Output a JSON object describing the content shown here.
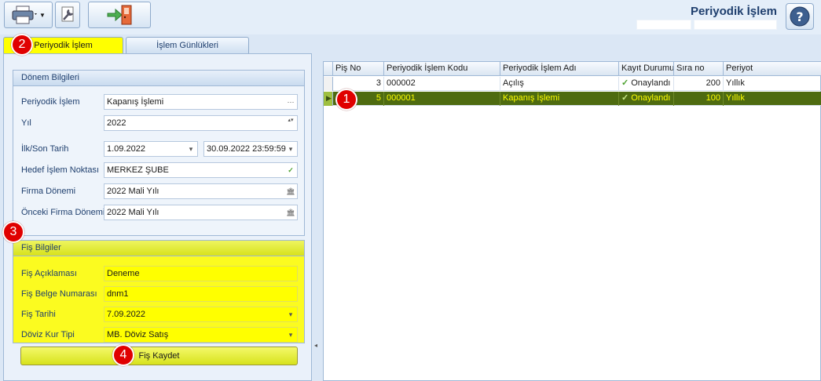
{
  "header": {
    "title": "Periyodik İşlem"
  },
  "tabs": [
    {
      "label": "Periyodik İşlem"
    },
    {
      "label": "İşlem Günlükleri"
    }
  ],
  "donem": {
    "title": "Dönem Bilgileri",
    "fields": [
      {
        "label": "Periyodik İşlem",
        "value": "Kapanış İşlemi",
        "button": "···"
      },
      {
        "label": "Yıl",
        "value": "2022",
        "button": "▴▾"
      },
      {
        "label": "İlk/Son Tarih",
        "value": "1.09.2022",
        "value2": "30.09.2022 23:59:59",
        "button": "▾"
      },
      {
        "label": "Hedef İşlem Noktası",
        "value": "MERKEZ ŞUBE",
        "button": "✓"
      },
      {
        "label": "Firma Dönemi",
        "value": "2022 Mali Yılı",
        "button": "🏛"
      },
      {
        "label": "Önceki Firma Dönemi",
        "value": "2022 Mali Yılı",
        "button": "🏛"
      }
    ]
  },
  "fis": {
    "title": "Fiş Bilgiler",
    "fields": [
      {
        "label": "Fiş Açıklaması",
        "value": "Deneme"
      },
      {
        "label": "Fiş Belge Numarası",
        "value": "dnm1"
      },
      {
        "label": "Fiş Tarihi",
        "value": "7.09.2022",
        "button": "▾"
      },
      {
        "label": "Döviz Kur Tipi",
        "value": "MB. Döviz Satış",
        "button": "▾"
      }
    ],
    "save_label": "Fiş Kaydet"
  },
  "grid": {
    "columns": [
      "Piş No",
      "Periyodik İşlem Kodu",
      "Periyodik İşlem Adı",
      "Kayıt Durumu",
      "Sıra no",
      "Periyot"
    ],
    "rows": [
      {
        "pis_no": "3",
        "kod": "000002",
        "ad": "Açılış",
        "durum": "Onaylandı",
        "sira": "200",
        "periyot": "Yıllık",
        "selected": false
      },
      {
        "pis_no": "5",
        "kod": "000001",
        "ad": "Kapanış İşlemi",
        "durum": "Onaylandı",
        "sira": "100",
        "periyot": "Yıllık",
        "selected": true
      }
    ]
  },
  "badges": [
    "1",
    "2",
    "3",
    "4"
  ],
  "colors": {
    "highlight": "#ffff00",
    "selected_row": "#4e6b10",
    "badge": "#e00000"
  }
}
